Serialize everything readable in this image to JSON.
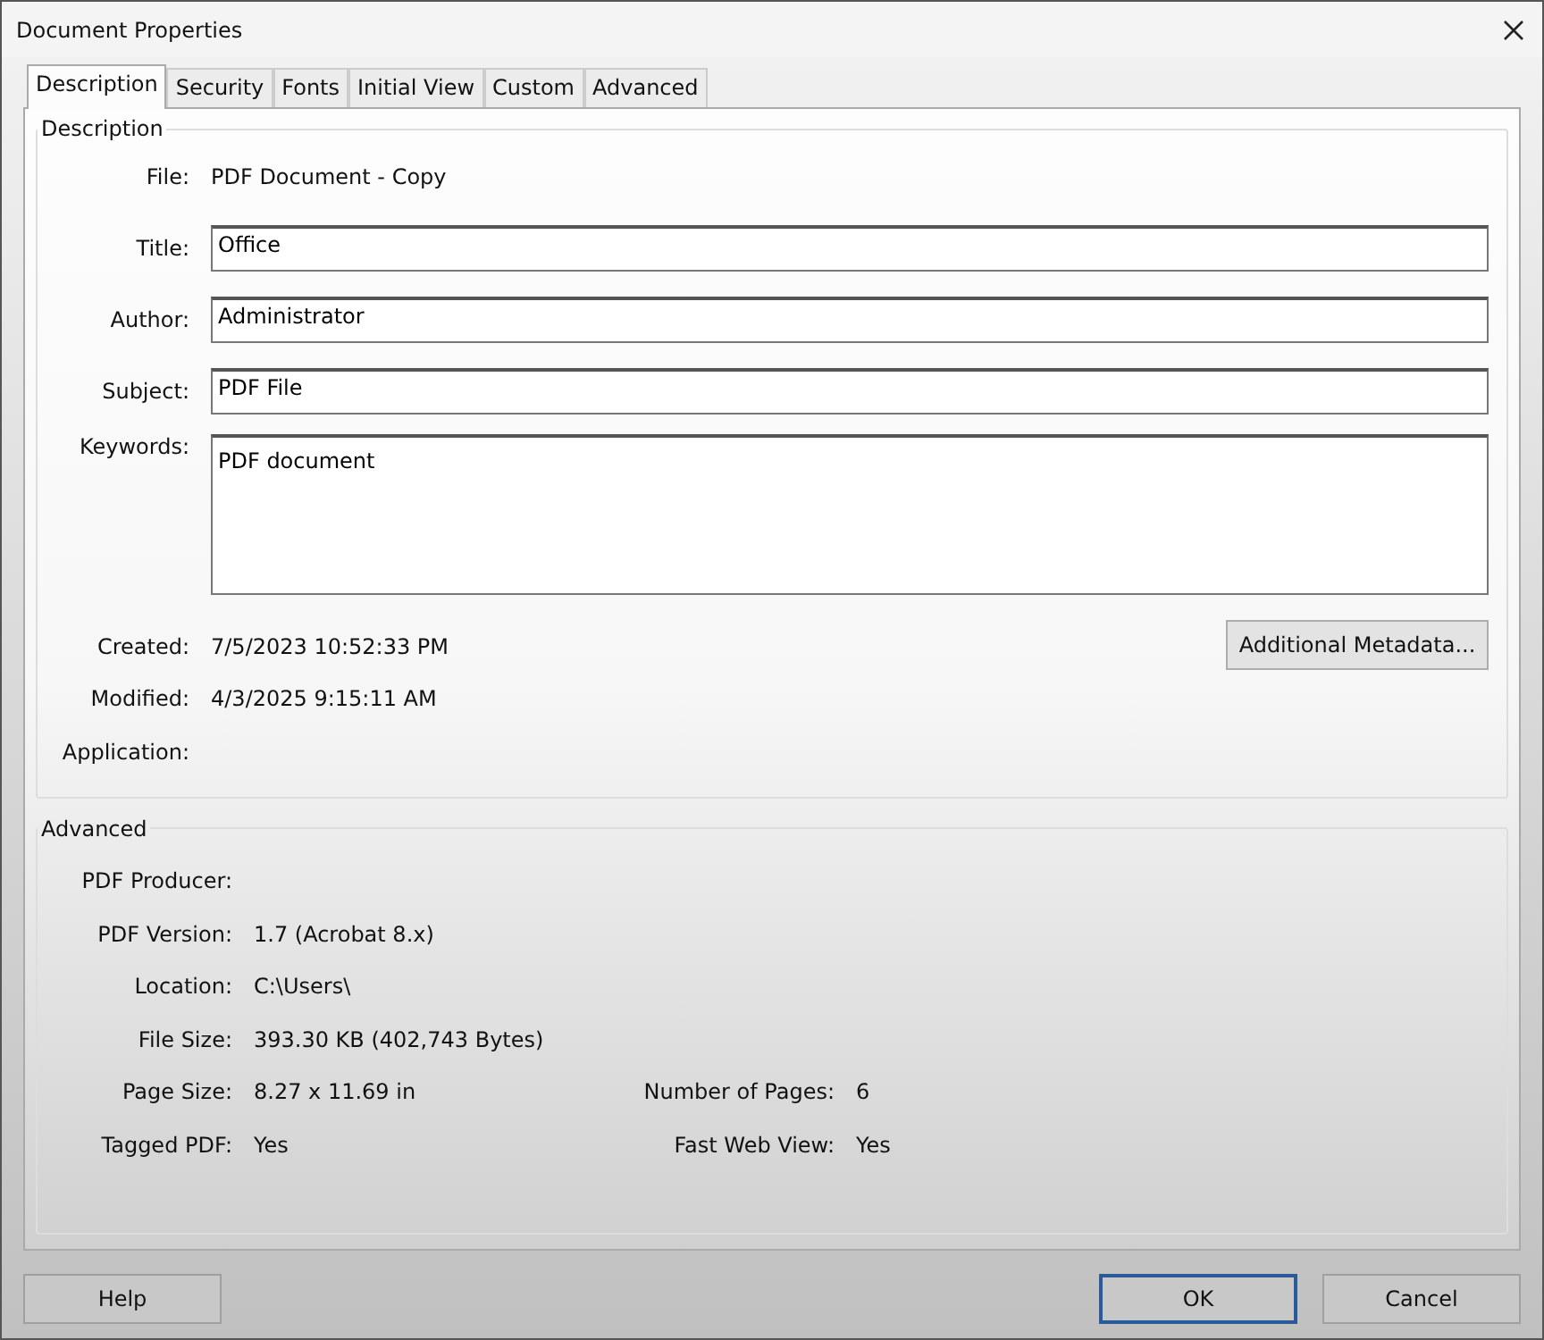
{
  "window": {
    "title": "Document Properties"
  },
  "tabs": [
    {
      "label": "Description",
      "selected": true
    },
    {
      "label": "Security",
      "selected": false
    },
    {
      "label": "Fonts",
      "selected": false
    },
    {
      "label": "Initial View",
      "selected": false
    },
    {
      "label": "Custom",
      "selected": false
    },
    {
      "label": "Advanced",
      "selected": false
    }
  ],
  "description": {
    "title": "Description",
    "file": {
      "label": "File:",
      "value": "PDF Document - Copy"
    },
    "fields": [
      {
        "label": "Title:",
        "value": "Office",
        "kind": "line"
      },
      {
        "label": "Author:",
        "value": "Administrator",
        "kind": "line"
      },
      {
        "label": "Subject:",
        "value": "PDF File",
        "kind": "line"
      },
      {
        "label": "Keywords:",
        "value": "PDF document",
        "kind": "area"
      }
    ],
    "info": [
      {
        "label": "Created:",
        "value": "7/5/2023 10:52:33 PM"
      },
      {
        "label": "Modified:",
        "value": "4/3/2025 9:15:11 AM"
      },
      {
        "label": "Application:"
      }
    ],
    "metadata_button": "Additional Metadata..."
  },
  "advanced": {
    "title": "Advanced",
    "rows": [
      {
        "label": "PDF Producer:"
      },
      {
        "label": "PDF Version:",
        "value": "1.7 (Acrobat 8.x)"
      },
      {
        "label": "Location:",
        "value": "C:\\Users\\"
      },
      {
        "label": "File Size:",
        "value": "393.30 KB (402,743 Bytes)"
      },
      {
        "label": "Page Size:",
        "value": "8.27 x 11.69 in",
        "label_2": "Number of Pages:",
        "value_2": "6"
      },
      {
        "label": "Tagged PDF:",
        "value": "Yes",
        "label_2": "Fast Web View:",
        "value_2": "Yes"
      }
    ]
  },
  "buttons_left": [
    {
      "label": "Help",
      "default": false
    }
  ],
  "buttons_right": [
    {
      "label": "OK",
      "default": true
    },
    {
      "label": "Cancel",
      "default": false
    }
  ]
}
